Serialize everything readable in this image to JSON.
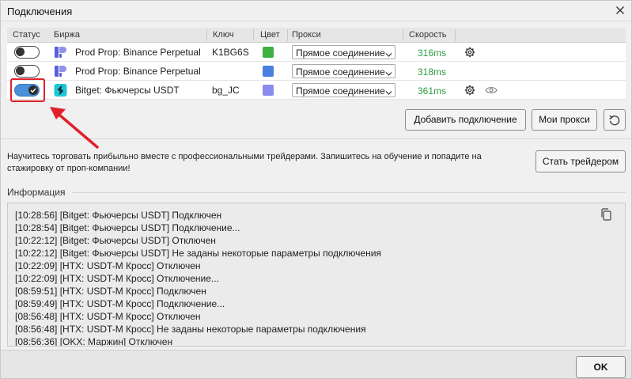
{
  "window": {
    "title": "Подключения"
  },
  "table": {
    "headers": {
      "status": "Статус",
      "exchange": "Биржа",
      "key": "Ключ",
      "color": "Цвет",
      "proxy": "Прокси",
      "speed": "Скорость"
    },
    "rows": [
      {
        "enabled": false,
        "exchange": "Prod Prop: Binance Perpetual",
        "exchange_icon": "prop-icon",
        "key": "K1BG6S",
        "color": "#3cb043",
        "proxy": "Прямое соединение",
        "speed": "316ms",
        "show_eye": false
      },
      {
        "enabled": false,
        "exchange": "Prod Prop: Binance Perpetual",
        "exchange_icon": "prop-icon",
        "key": "",
        "color": "#4b7fe0",
        "proxy": "Прямое соединение",
        "speed": "318ms",
        "show_eye": false
      },
      {
        "enabled": true,
        "exchange": "Bitget: Фьючерсы USDT",
        "exchange_icon": "bitget-icon",
        "key": "bg_JC",
        "color": "#8a8cf0",
        "proxy": "Прямое соединение",
        "speed": "361ms",
        "show_eye": true
      }
    ]
  },
  "buttons": {
    "add_connection": "Добавить подключение",
    "my_proxies": "Мои прокси",
    "become_trader": "Стать трейдером",
    "ok": "OK"
  },
  "promo": {
    "text": "Научитесь торговать прибыльно вместе с профессиональными трейдерами. Запишитесь на обучение и попадите на стажировку от проп-компании!"
  },
  "info": {
    "title": "Информация",
    "log": [
      "[10:28:56] [Bitget: Фьючерсы USDT] Подключен",
      "[10:28:54] [Bitget: Фьючерсы USDT] Подключение...",
      "[10:22:12] [Bitget: Фьючерсы USDT] Отключен",
      "[10:22:12] [Bitget: Фьючерсы USDT] Не заданы некоторые параметры подключения",
      "[10:22:09] [HTX: USDT-M Кросс] Отключен",
      "[10:22:09] [HTX: USDT-M Кросс] Отключение...",
      "[08:59:51] [HTX: USDT-M Кросс] Подключен",
      "[08:59:49] [HTX: USDT-M Кросс] Подключение...",
      "[08:56:48] [HTX: USDT-M Кросс] Отключен",
      "[08:56:48] [HTX: USDT-M Кросс] Не заданы некоторые параметры подключения",
      "[08:56:36] [OKX: Маржин] Отключен"
    ]
  },
  "colors": {
    "speed": "#2c9c43",
    "annotation": "#e0202a",
    "toggle_on": "#4a90d9"
  }
}
